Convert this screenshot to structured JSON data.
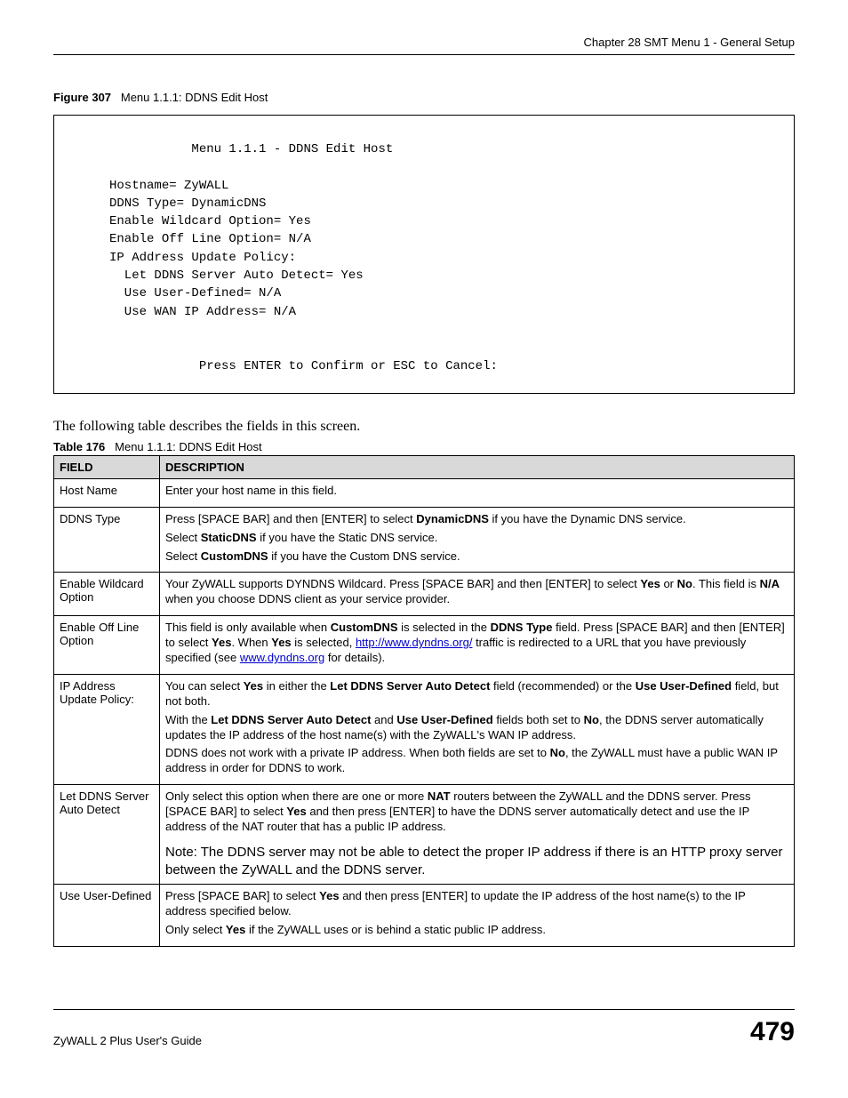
{
  "header": {
    "chapter_line": "Chapter 28 SMT Menu 1 - General Setup"
  },
  "figure": {
    "label": "Figure 307",
    "title": "Menu 1.1.1: DDNS Edit Host"
  },
  "terminal": {
    "title_line": "                Menu 1.1.1 - DDNS Edit Host",
    "l1": "     Hostname= ZyWALL",
    "l2": "     DDNS Type= DynamicDNS",
    "l3": "     Enable Wildcard Option= Yes",
    "l4": "     Enable Off Line Option= N/A",
    "l5": "     IP Address Update Policy:",
    "l6": "       Let DDNS Server Auto Detect= Yes",
    "l7": "       Use User-Defined= N/A",
    "l8": "       Use WAN IP Address= N/A",
    "footer_line": "                 Press ENTER to Confirm or ESC to Cancel:"
  },
  "intro_text": "The following table describes the fields in this screen.",
  "table_caption": {
    "label": "Table 176",
    "title": "Menu 1.1.1: DDNS Edit Host"
  },
  "table": {
    "headers": {
      "field": "FIELD",
      "description": "DESCRIPTION"
    },
    "rows": {
      "r1": {
        "field": "Host Name",
        "d1": "Enter your host name in this field."
      },
      "r2": {
        "field": "DDNS Type",
        "d1a": "Press [SPACE BAR] and then [ENTER] to select ",
        "d1b": "DynamicDNS",
        "d1c": " if you have the Dynamic DNS service.",
        "d2a": "Select ",
        "d2b": "StaticDNS",
        "d2c": " if you have the Static DNS service.",
        "d3a": "Select ",
        "d3b": "CustomDNS",
        "d3c": " if you have the Custom DNS service."
      },
      "r3": {
        "field": "Enable Wildcard Option",
        "d1a": "Your ZyWALL supports DYNDNS Wildcard. Press [SPACE BAR] and then [ENTER] to select ",
        "d1b": "Yes",
        "d1c": " or ",
        "d1d": "No",
        "d1e": ". This field is ",
        "d1f": "N/A",
        "d1g": " when you choose DDNS client as your service provider."
      },
      "r4": {
        "field": "Enable Off Line Option",
        "d1a": "This field is only available when ",
        "d1b": "CustomDNS",
        "d1c": " is selected in the ",
        "d1d": "DDNS Type",
        "d1e": " field. Press [SPACE BAR] and then [ENTER] to select ",
        "d1f": "Yes",
        "d1g": ". When ",
        "d1h": "Yes",
        "d1i": " is selected, ",
        "link1": "http://www.dyndns.org/",
        "d1j": " traffic is redirected to a URL that you have previously specified (see ",
        "link2": "www.dyndns.org",
        "d1k": " for details)."
      },
      "r5": {
        "field": "IP Address Update Policy:",
        "d1a": "You can select ",
        "d1b": "Yes",
        "d1c": " in either the ",
        "d1d": "Let DDNS Server Auto Detect",
        "d1e": " field (recommended) or the ",
        "d1f": "Use User-Defined",
        "d1g": " field, but not both.",
        "d2a": "With the ",
        "d2b": "Let DDNS Server Auto Detect",
        "d2c": " and ",
        "d2d": "Use User-Defined",
        "d2e": " fields both set to ",
        "d2f": "No",
        "d2g": ", the DDNS server automatically updates the IP address of the host name(s) with the ZyWALL's WAN IP address.",
        "d3a": "DDNS does not work with a private IP address. When both fields are set to ",
        "d3b": "No",
        "d3c": ", the ZyWALL must have a public WAN IP address in order for DDNS to work."
      },
      "r6": {
        "field": "Let DDNS Server Auto Detect",
        "d1a": "Only select this option when there are one or more ",
        "d1b": "NAT",
        "d1c": " routers between the ZyWALL and the DDNS server. Press [SPACE BAR] to select ",
        "d1d": "Yes",
        "d1e": " and then press [ENTER] to have the DDNS server automatically detect and use the IP address of the NAT router that has a public IP address.",
        "note_label": "Note: ",
        "note_body": "The DDNS server may not be able to detect the proper IP address if there is an HTTP proxy server between the ZyWALL and the DDNS server."
      },
      "r7": {
        "field": "Use User-Defined",
        "d1a": "Press [SPACE BAR] to select ",
        "d1b": "Yes",
        "d1c": " and then press [ENTER] to update the IP address of the host name(s) to the IP address specified below.",
        "d2a": "Only select ",
        "d2b": "Yes",
        "d2c": " if the ZyWALL uses or is behind a static public IP address."
      }
    }
  },
  "footer": {
    "guide": "ZyWALL 2 Plus User's Guide",
    "page": "479"
  }
}
